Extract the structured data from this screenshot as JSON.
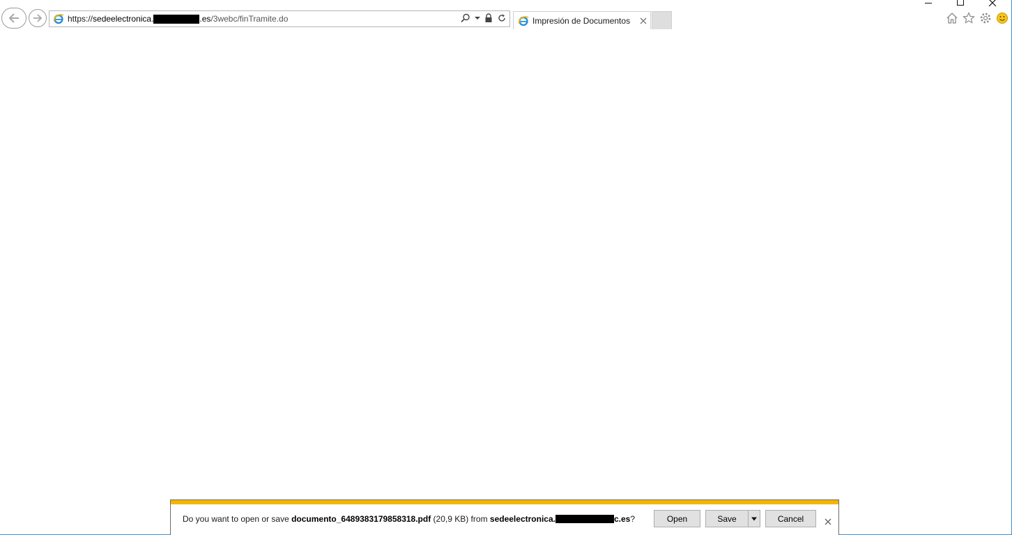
{
  "browser": {
    "address": {
      "scheme": "https://",
      "host_prefix": "sedeelectronica.",
      "host_suffix": ".es",
      "path": "/3webc/finTramite.do"
    },
    "tab": {
      "title": "Impresión de Documentos"
    },
    "icons": {
      "back": "back-arrow-icon",
      "forward": "forward-arrow-icon",
      "search": "search-icon",
      "lock": "lock-icon",
      "refresh": "refresh-icon",
      "home": "home-icon",
      "favorites": "star-icon",
      "settings": "gear-icon",
      "feedback": "smiley-icon"
    }
  },
  "download_bar": {
    "prompt_prefix": "Do you want to open or save ",
    "file_name": "documento_6489383179858318.pdf",
    "file_size": " (20,9 KB) from ",
    "source_prefix": "sedeelectronica.",
    "source_suffix": "c.es",
    "prompt_suffix": "?",
    "buttons": {
      "open": "Open",
      "save": "Save",
      "cancel": "Cancel"
    },
    "accent_color": "#f2b600"
  }
}
